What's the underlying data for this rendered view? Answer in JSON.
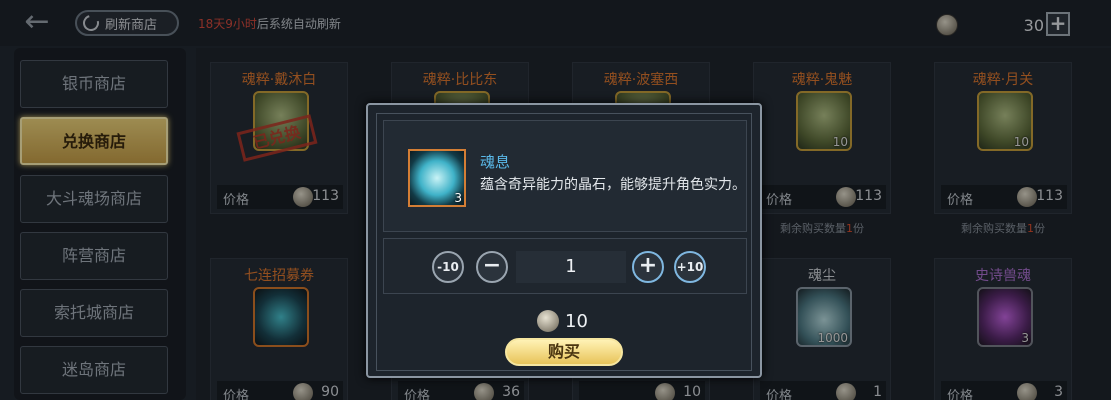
{
  "topbar": {
    "refresh_label": "刷新商店",
    "timer_red": "18天9小时",
    "timer_rest": "后系统自动刷新",
    "currency_value": "30",
    "plus": "+"
  },
  "sidebar": {
    "items": [
      {
        "label": "银币商店"
      },
      {
        "label": "兑换商店"
      },
      {
        "label": "大斗魂场商店"
      },
      {
        "label": "阵营商店"
      },
      {
        "label": "索托城商店"
      },
      {
        "label": "迷岛商店"
      }
    ]
  },
  "cards": [
    {
      "title": "魂粹·戴沐白",
      "price_label": "价格",
      "price": "113",
      "stamp": "已兑换"
    },
    {
      "title": "魂粹·比比东"
    },
    {
      "title": "魂粹·波塞西"
    },
    {
      "title": "魂粹·鬼魅",
      "price_label": "价格",
      "price": "113",
      "qty": "10",
      "remain_prefix": "剩余购买数量",
      "remain_num": "1",
      "remain_suffix": "份"
    },
    {
      "title": "魂粹·月关",
      "price_label": "价格",
      "price": "113",
      "qty": "10",
      "remain_prefix": "剩余购买数量",
      "remain_num": "1",
      "remain_suffix": "份"
    },
    {
      "title": "七连招募券",
      "price_label": "价格",
      "price": "90"
    },
    {
      "price_label": "价格",
      "price": "36"
    },
    {
      "price": "10"
    },
    {
      "title": "魂尘",
      "price_label": "价格",
      "price": "1",
      "qty": "1000"
    },
    {
      "title": "史诗兽魂",
      "price_label": "价格",
      "price": "3",
      "qty": "3"
    }
  ],
  "modal": {
    "item_name": "魂息",
    "item_qty": "3",
    "item_desc": "蕴含奇异能力的晶石，能够提升角色实力。",
    "minus10": "-10",
    "minus": "−",
    "quantity": "1",
    "plus": "+",
    "plus10": "+10",
    "cost": "10",
    "buy_label": "购买"
  },
  "icons": [
    "back-arrow-icon",
    "refresh-icon",
    "coin-icon",
    "plus-icon"
  ],
  "colors": {
    "accent_gold": "#e8c45a",
    "title_orange": "#e27a31",
    "timer_red": "#d64b3e",
    "item_name_blue": "#5ab8e8"
  }
}
